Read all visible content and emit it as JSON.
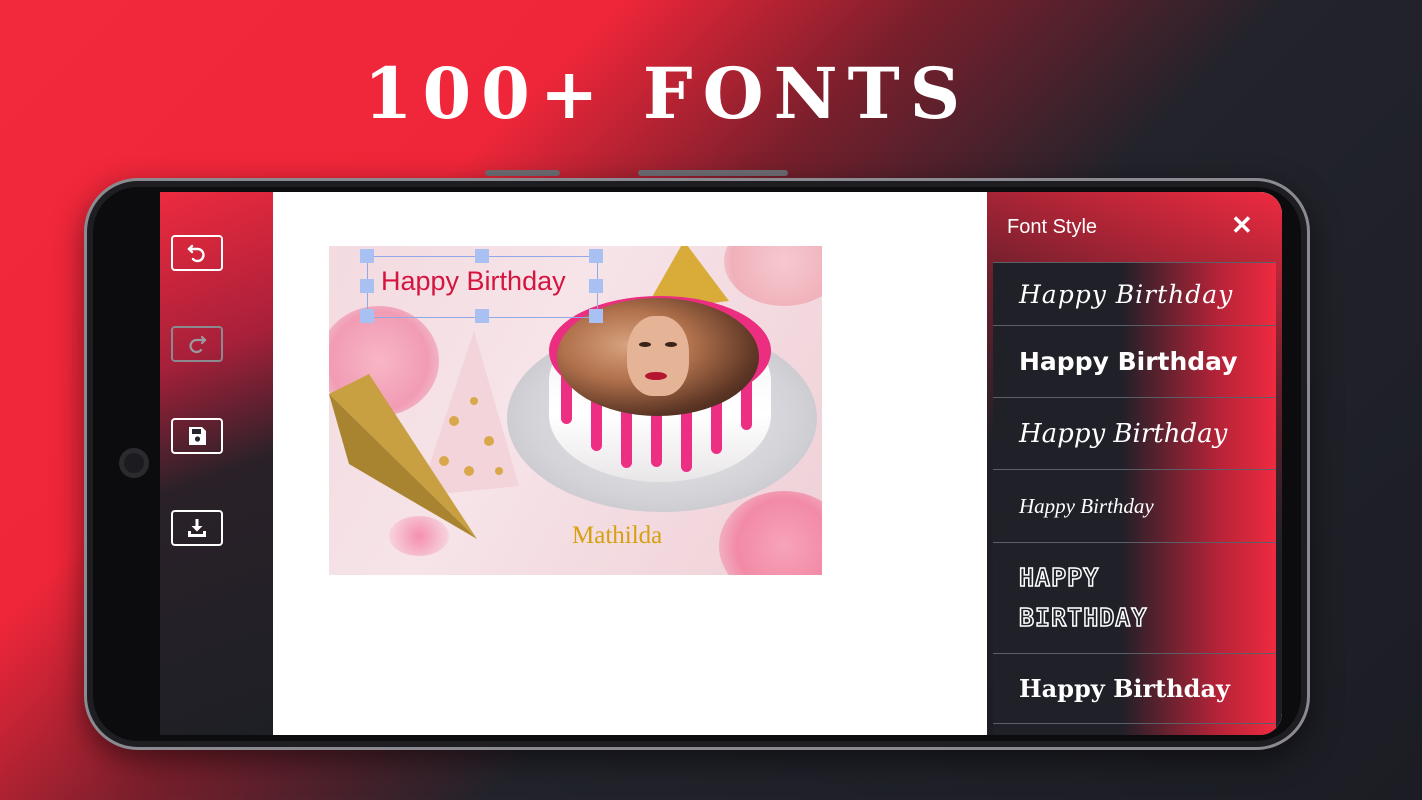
{
  "headline": "100+ FONTS",
  "toolbar": {
    "undo_icon": "undo-icon",
    "redo_icon": "redo-icon",
    "save_icon": "save-icon",
    "download_icon": "download-icon"
  },
  "card": {
    "greeting_text": "Happy Birthday",
    "name_text": "Mathilda"
  },
  "font_panel": {
    "title": "Font Style",
    "close_icon": "✕",
    "items": [
      {
        "label": "Happy Birthday"
      },
      {
        "label": "Happy Birthday"
      },
      {
        "label": "Happy Birthday"
      },
      {
        "label": "Happy Birthday"
      },
      {
        "label": "HAPPY BIRTHDAY"
      },
      {
        "label": "Happy Birthday"
      }
    ]
  },
  "colors": {
    "accent": "#ef2a40",
    "dark": "#1e1f26",
    "greeting": "#d5143f",
    "name": "#d7a010"
  }
}
